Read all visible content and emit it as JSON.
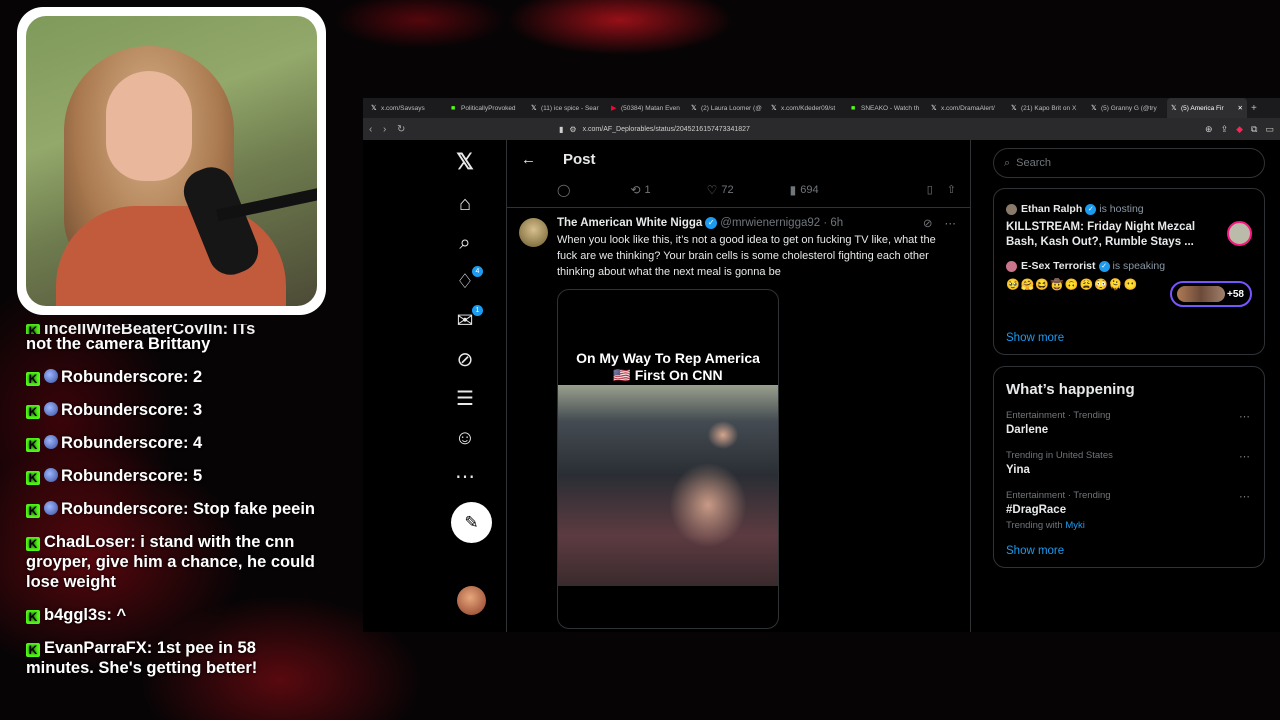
{
  "chat": [
    {
      "user": "",
      "text": "not the camera Brittany",
      "partial_top": "inceIIWifeBeaterCoyIIn: ITs"
    },
    {
      "user": "Robunderscore",
      "text": "2",
      "badge": true
    },
    {
      "user": "Robunderscore",
      "text": "3",
      "badge": true
    },
    {
      "user": "Robunderscore",
      "text": "4",
      "badge": true
    },
    {
      "user": "Robunderscore",
      "text": "5",
      "badge": true
    },
    {
      "user": "Robunderscore",
      "text": "Stop fake peein",
      "badge": true
    },
    {
      "user": "ChadLoser",
      "text": "i stand with the cnn groyper, give him a chance, he could lose weight",
      "badge": false
    },
    {
      "user": "b4ggl3s",
      "text": "^",
      "badge": false
    },
    {
      "user": "EvanParraFX",
      "text": "1st pee in 58 minutes. She's getting better!",
      "badge": false
    }
  ],
  "browser": {
    "tabs": [
      {
        "label": "x.com/Savsays",
        "icon": "x-icon"
      },
      {
        "label": "PoliticallyProvoked",
        "icon": "kick-icon"
      },
      {
        "label": "(11) ice spice - Sear",
        "icon": "x-icon"
      },
      {
        "label": "(50384) Matan Even",
        "icon": "youtube-icon"
      },
      {
        "label": "(2) Laura Loomer (@",
        "icon": "x-icon"
      },
      {
        "label": "x.com/Kdeder09/st",
        "icon": "x-icon"
      },
      {
        "label": "SNEAKO - Watch th",
        "icon": "kick-icon"
      },
      {
        "label": "x.com/DramaAlert/",
        "icon": "x-icon"
      },
      {
        "label": "(21) Kapo Brit on X",
        "icon": "x-icon"
      },
      {
        "label": "(5) Granny G (@try",
        "icon": "x-icon"
      },
      {
        "label": "(5) America Fir",
        "icon": "x-icon",
        "active": true
      }
    ],
    "url": "x.com/AF_Deplorables/status/2045216157473341827"
  },
  "x": {
    "nav_badges": {
      "notifications": "4",
      "messages": "1"
    },
    "post_header": {
      "back": "←",
      "title": "Post"
    },
    "actions": {
      "replies": "",
      "reposts": "1",
      "likes": "72",
      "views": "694"
    },
    "reply": {
      "name": "The American White Nigga",
      "handle": "@mrwienernigga92",
      "time": "· 6h",
      "text": "When you look like this, it’s not a good idea to get on fucking TV like, what the fuck are we thinking? Your brain cells is some cholesterol fighting each other thinking about what the next meal is gonna be",
      "media_caption_line1": "On My Way To Rep America",
      "media_caption_line2": "🇺🇸 First On CNN"
    },
    "search": {
      "placeholder": "Search"
    },
    "spaces": [
      {
        "host": "Ethan Ralph",
        "status": "is hosting",
        "title": "KILLSTREAM: Friday Night Mezcal Bash, Kash Out?, Rumble Stays ..."
      },
      {
        "host": "E-Sex Terrorist",
        "status": "is speaking",
        "emojis": "🥹🤗😆🤠🙃😩😳🫠😶",
        "listeners": "+58"
      }
    ],
    "spaces_show_more": "Show more",
    "trends_title": "What’s happening",
    "trends": [
      {
        "context": "Entertainment · Trending",
        "name": "Darlene",
        "sub": ""
      },
      {
        "context": "Trending in United States",
        "name": "Yina",
        "sub": ""
      },
      {
        "context": "Entertainment · Trending",
        "name": "#DragRace",
        "sub_prefix": "Trending with",
        "sub_link": "Myki"
      }
    ],
    "trends_show_more": "Show more"
  }
}
